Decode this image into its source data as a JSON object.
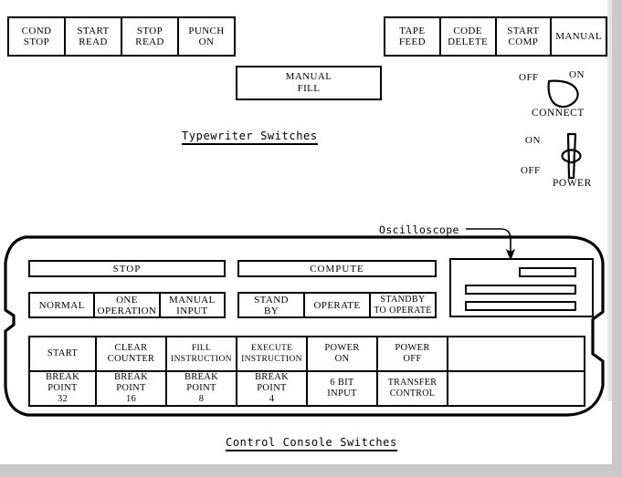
{
  "page": {
    "background_color": "#ffffff",
    "ink_color": "#000000",
    "edge_band_color": "#c9c9c9"
  },
  "typewriter_switches": {
    "caption": "Typewriter Switches",
    "left_group": [
      {
        "line1": "COND",
        "line2": "STOP"
      },
      {
        "line1": "START",
        "line2": "READ"
      },
      {
        "line1": "STOP",
        "line2": "READ"
      },
      {
        "line1": "PUNCH",
        "line2": "ON"
      }
    ],
    "right_group": [
      {
        "line1": "TAPE",
        "line2": "FEED"
      },
      {
        "line1": "CODE",
        "line2": "DELETE"
      },
      {
        "line1": "START",
        "line2": "COMP"
      },
      {
        "line1": "MANUAL",
        "line2": ""
      }
    ],
    "manual_fill": {
      "line1": "MANUAL",
      "line2": "FILL"
    }
  },
  "connect_switch": {
    "name": "CONNECT",
    "off_label": "OFF",
    "on_label": "ON",
    "icon": "rotary-knob-icon"
  },
  "power_switch": {
    "name": "POWER",
    "on_label": "ON",
    "off_label": "OFF",
    "icon": "toggle-lever-icon"
  },
  "console": {
    "caption": "Control Console Switches",
    "stop_header": "STOP",
    "compute_header": "COMPUTE",
    "stop_modes": [
      {
        "line1": "NORMAL",
        "line2": ""
      },
      {
        "line1": "ONE",
        "line2": "OPERATION"
      },
      {
        "line1": "MANUAL",
        "line2": "INPUT"
      }
    ],
    "compute_modes": [
      {
        "line1": "STAND",
        "line2": "BY"
      },
      {
        "line1": "OPERATE",
        "line2": ""
      },
      {
        "line1": "STANDBY",
        "line2": "TO OPERATE"
      }
    ],
    "main_grid": {
      "top_row": [
        {
          "line1": "START",
          "line2": ""
        },
        {
          "line1": "CLEAR",
          "line2": "COUNTER"
        },
        {
          "line1": "FILL",
          "line2": "INSTRUCTION"
        },
        {
          "line1": "EXECUTE",
          "line2": "INSTRUCTION"
        },
        {
          "line1": "POWER",
          "line2": "ON"
        },
        {
          "line1": "POWER",
          "line2": "OFF"
        },
        {
          "line1": "",
          "line2": ""
        }
      ],
      "bottom_row": [
        {
          "line1": "BREAK",
          "line2": "POINT",
          "line3": "32"
        },
        {
          "line1": "BREAK",
          "line2": "POINT",
          "line3": "16"
        },
        {
          "line1": "BREAK",
          "line2": "POINT",
          "line3": "8"
        },
        {
          "line1": "BREAK",
          "line2": "POINT",
          "line3": "4"
        },
        {
          "line1": "6 BIT",
          "line2": "INPUT",
          "line3": ""
        },
        {
          "line1": "TRANSFER",
          "line2": "CONTROL",
          "line3": ""
        },
        {
          "line1": "",
          "line2": "",
          "line3": ""
        }
      ]
    }
  },
  "oscilloscope": {
    "label": "Oscilloscope",
    "bar_count": 3
  }
}
